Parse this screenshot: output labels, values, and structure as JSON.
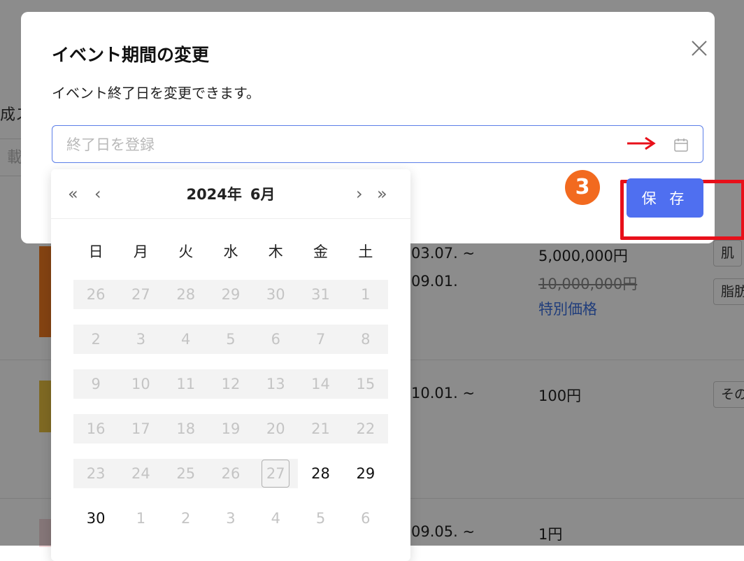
{
  "background": {
    "left_text": "成ス",
    "left_input": "載",
    "rows": [
      {
        "period_lines": [
          "03.07. ~",
          "09.01."
        ],
        "price_lines": [
          "5,000,000円"
        ],
        "old_price": "10,000,000円",
        "special_label": "特別価格",
        "tags": [
          "肌",
          "脂肪"
        ]
      },
      {
        "period_lines": [
          "10.01. ~"
        ],
        "price_lines": [
          "100円"
        ],
        "tags": [
          "その"
        ]
      },
      {
        "period_lines": [
          "09.05. ~"
        ],
        "price_lines": [
          "1円"
        ],
        "tags": []
      }
    ]
  },
  "modal": {
    "title": "イベント期間の変更",
    "description": "イベント終了日を変更できます。",
    "date_input": {
      "placeholder": "終了日を登録",
      "value": ""
    },
    "save_label": "保 存",
    "step_badge": "3",
    "highlight_color": "#e8101a",
    "accent_color": "#4f6ff0",
    "icons": [
      "close-icon",
      "calendar-icon",
      "arrow-right-icon"
    ]
  },
  "calendar": {
    "year_label": "2024年",
    "month_label": "6月",
    "nav": {
      "prev_year": "«",
      "prev_month": "‹",
      "next_month": "›",
      "next_year": "»"
    },
    "weekdays": [
      "日",
      "月",
      "火",
      "水",
      "木",
      "金",
      "土"
    ],
    "weeks": [
      [
        {
          "d": "26",
          "s": "disabled"
        },
        {
          "d": "27",
          "s": "disabled"
        },
        {
          "d": "28",
          "s": "disabled"
        },
        {
          "d": "29",
          "s": "disabled"
        },
        {
          "d": "30",
          "s": "disabled"
        },
        {
          "d": "31",
          "s": "disabled"
        },
        {
          "d": "1",
          "s": "disabled"
        }
      ],
      [
        {
          "d": "2",
          "s": "disabled"
        },
        {
          "d": "3",
          "s": "disabled"
        },
        {
          "d": "4",
          "s": "disabled"
        },
        {
          "d": "5",
          "s": "disabled"
        },
        {
          "d": "6",
          "s": "disabled"
        },
        {
          "d": "7",
          "s": "disabled"
        },
        {
          "d": "8",
          "s": "disabled"
        }
      ],
      [
        {
          "d": "9",
          "s": "disabled"
        },
        {
          "d": "10",
          "s": "disabled"
        },
        {
          "d": "11",
          "s": "disabled"
        },
        {
          "d": "12",
          "s": "disabled"
        },
        {
          "d": "13",
          "s": "disabled"
        },
        {
          "d": "14",
          "s": "disabled"
        },
        {
          "d": "15",
          "s": "disabled"
        }
      ],
      [
        {
          "d": "16",
          "s": "disabled"
        },
        {
          "d": "17",
          "s": "disabled"
        },
        {
          "d": "18",
          "s": "disabled"
        },
        {
          "d": "19",
          "s": "disabled"
        },
        {
          "d": "20",
          "s": "disabled"
        },
        {
          "d": "21",
          "s": "disabled"
        },
        {
          "d": "22",
          "s": "disabled"
        }
      ],
      [
        {
          "d": "23",
          "s": "disabled"
        },
        {
          "d": "24",
          "s": "disabled"
        },
        {
          "d": "25",
          "s": "disabled"
        },
        {
          "d": "26",
          "s": "disabled"
        },
        {
          "d": "27",
          "s": "today"
        },
        {
          "d": "28",
          "s": "in"
        },
        {
          "d": "29",
          "s": "in"
        }
      ],
      [
        {
          "d": "30",
          "s": "in"
        },
        {
          "d": "1",
          "s": "out"
        },
        {
          "d": "2",
          "s": "out"
        },
        {
          "d": "3",
          "s": "out"
        },
        {
          "d": "4",
          "s": "out"
        },
        {
          "d": "5",
          "s": "out"
        },
        {
          "d": "6",
          "s": "out"
        }
      ]
    ]
  }
}
